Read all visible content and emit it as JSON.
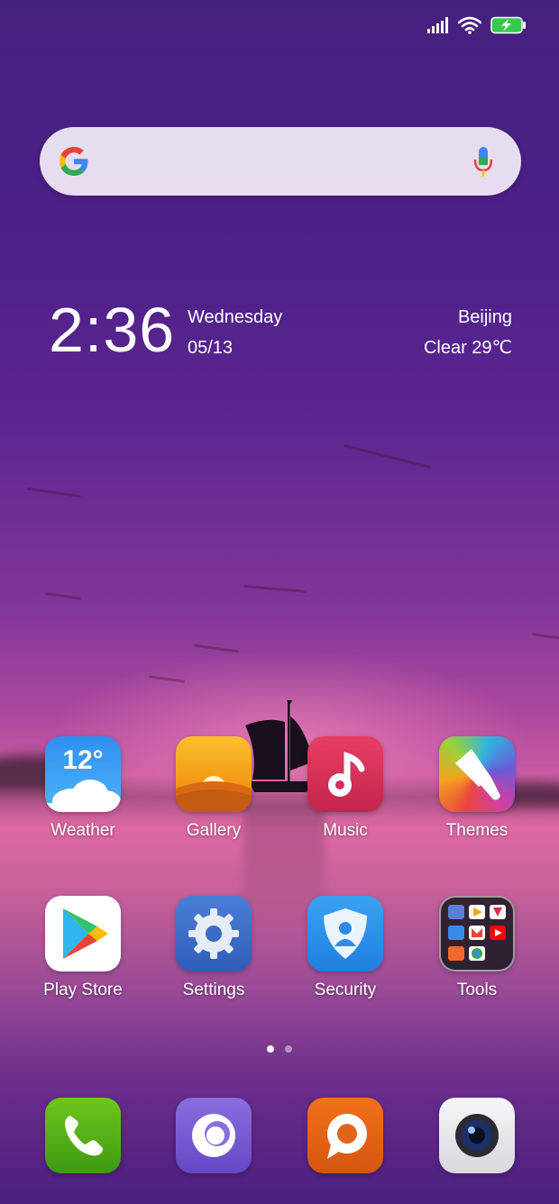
{
  "status_bar": {
    "icons": [
      "signal-icon",
      "wifi-icon",
      "battery-charging-icon"
    ]
  },
  "search": {
    "logo": "google-logo",
    "mic_icon": "mic-icon"
  },
  "clock_widget": {
    "time": "2:36",
    "day": "Wednesday",
    "date": "05/13",
    "city": "Beijing",
    "weather": "Clear  29℃"
  },
  "apps": [
    {
      "label": "Weather",
      "icon": "weather-icon",
      "temp": "12°"
    },
    {
      "label": "Gallery",
      "icon": "gallery-icon"
    },
    {
      "label": "Music",
      "icon": "music-icon"
    },
    {
      "label": "Themes",
      "icon": "themes-icon"
    },
    {
      "label": "Play Store",
      "icon": "play-store-icon"
    },
    {
      "label": "Settings",
      "icon": "settings-icon"
    },
    {
      "label": "Security",
      "icon": "security-icon"
    },
    {
      "label": "Tools",
      "icon": "tools-folder-icon"
    }
  ],
  "page_indicator": {
    "pages": 2,
    "current": 1
  },
  "dock": [
    {
      "icon": "phone-icon"
    },
    {
      "icon": "browser-icon"
    },
    {
      "icon": "messaging-icon"
    },
    {
      "icon": "camera-icon"
    }
  ],
  "colors": {
    "wallpaper_top": "#45217e",
    "wallpaper_glow": "#e06aa6",
    "battery_green": "#37c84f"
  }
}
